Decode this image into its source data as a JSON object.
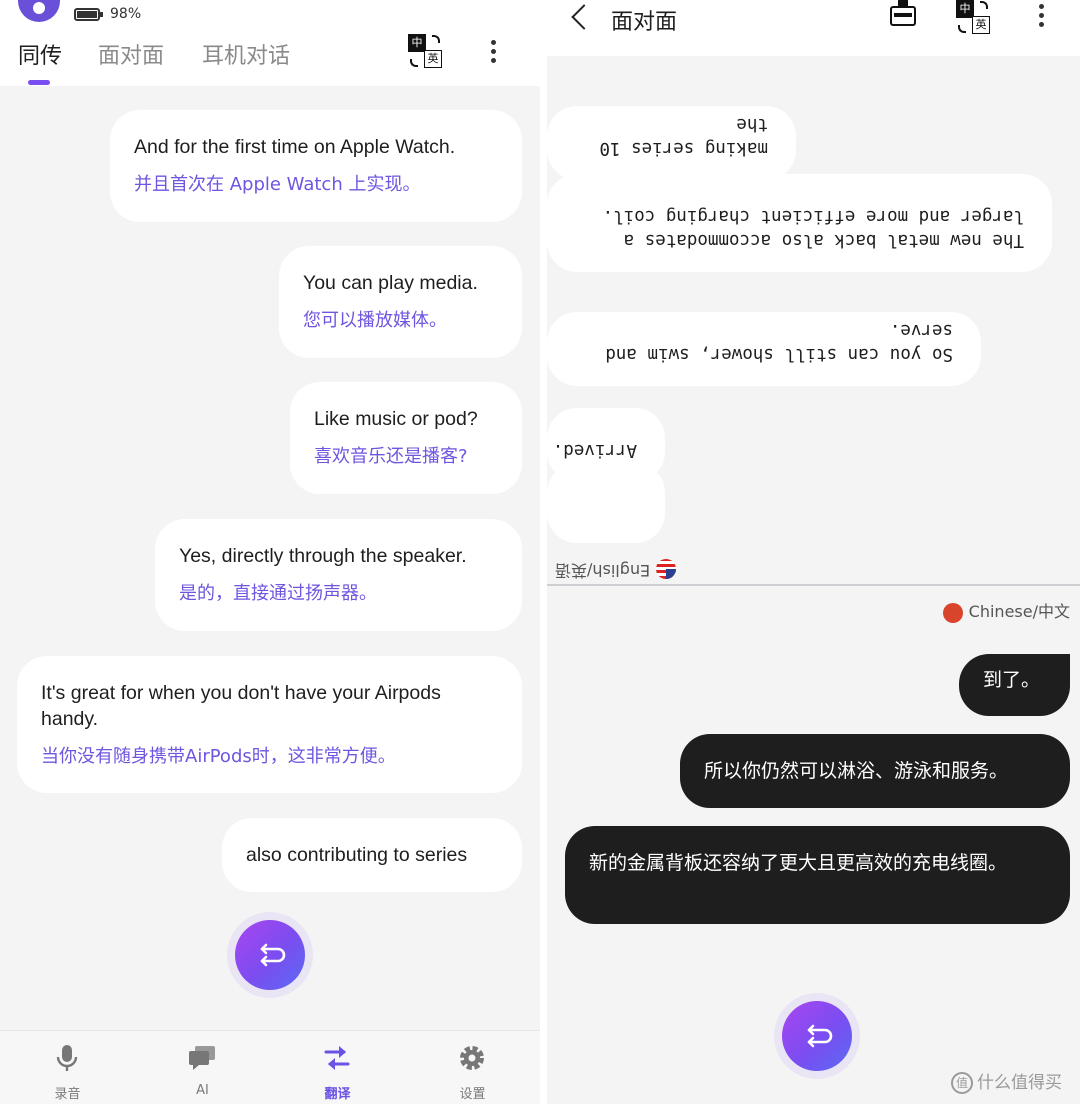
{
  "left": {
    "status": {
      "battery_text": "98%"
    },
    "tabs": [
      {
        "label": "同传"
      },
      {
        "label": "面对面"
      },
      {
        "label": "耳机对话"
      }
    ],
    "lang_icon": {
      "zh": "中",
      "en": "英"
    },
    "messages": [
      {
        "source": "And for the first time on Apple Watch.",
        "translation": "并且首次在 Apple Watch 上实现。"
      },
      {
        "source": "You can play media.",
        "translation": "您可以播放媒体。"
      },
      {
        "source": "Like music or pod?",
        "translation": "喜欢音乐还是播客?"
      },
      {
        "source": "Yes, directly through the speaker.",
        "translation": "是的，直接通过扬声器。"
      },
      {
        "source": "It's great for when you don't have your Airpods handy.",
        "translation": "当你没有随身携带AirPods时，这非常方便。"
      },
      {
        "source": "also contributing to series",
        "translation": ""
      }
    ],
    "nav": [
      {
        "label": "录音",
        "icon": "mic-icon"
      },
      {
        "label": "AI",
        "icon": "chat-icon"
      },
      {
        "label": "翻译",
        "icon": "swap-icon"
      },
      {
        "label": "设置",
        "icon": "gear-icon"
      }
    ],
    "colors": {
      "accent": "#6f55e0",
      "background": "#f4f4f5"
    }
  },
  "right": {
    "title": "面对面",
    "lang_icon": {
      "zh": "中",
      "en": "英"
    },
    "flipped_messages": [
      {
        "text": "making series 10 the"
      },
      {
        "text": "The new metal back also accommodates a larger and more efficient charging coil."
      },
      {
        "text": "So you can still shower, swim and serve."
      },
      {
        "text": "Arrived."
      }
    ],
    "top_language": "English/英语",
    "bottom_language": "Chinese/中文",
    "chinese_messages": [
      {
        "text": "到了。"
      },
      {
        "text": "所以你仍然可以淋浴、游泳和服务。"
      },
      {
        "text": "新的金属背板还容纳了更大且更高效的充电线圈。"
      }
    ],
    "watermark": "什么值得买",
    "watermark_logo": "值"
  }
}
